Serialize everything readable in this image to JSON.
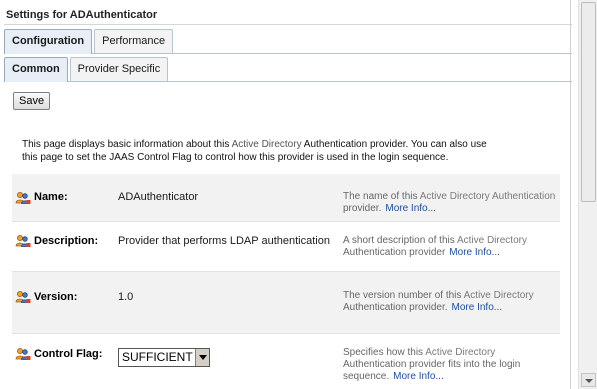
{
  "header": {
    "title": "Settings for ADAuthenticator"
  },
  "tabs_primary": [
    {
      "label": "Configuration",
      "active": true
    },
    {
      "label": "Performance",
      "active": false
    }
  ],
  "tabs_secondary": [
    {
      "label": "Common",
      "active": true
    },
    {
      "label": "Provider Specific",
      "active": false
    }
  ],
  "toolbar": {
    "save_label": "Save"
  },
  "intro": {
    "line1_a": "This page displays basic information about this ",
    "line1_hl": "Active Directory",
    "line1_b": " Authentication provider.  You can also use",
    "line2": "this page to set the JAAS Control Flag to control how this provider is used in the login sequence."
  },
  "fields": {
    "name": {
      "label": "Name:",
      "value": "ADAuthenticator",
      "help_a": "The name of this ",
      "help_hl": "Active Directory Authentication",
      "help_b": "provider.",
      "more": "More Info..."
    },
    "description": {
      "label": "Description:",
      "value": "Provider that performs LDAP authentication",
      "help_a": "A short description of this ",
      "help_hl": "Active Directory",
      "help_b": "Authentication provider",
      "more": "More Info..."
    },
    "version": {
      "label": "Version:",
      "value": "1.0",
      "help_a": "The version number of this ",
      "help_hl": "Active Directory",
      "help_b": "Authentication provider.",
      "more": "More Info..."
    },
    "control_flag": {
      "label": "Control Flag:",
      "value": "SUFFICIENT",
      "help_a": "Specifies how this ",
      "help_hl": "Active Directory",
      "help_b": "Authentication provider fits into the login",
      "help_c": "sequence.",
      "more": "More Info..."
    }
  },
  "icons": {
    "field": "people-settings-icon"
  },
  "colors": {
    "link": "#1f4ea0",
    "tab_active": "#e7eef5",
    "row_shade": "#f2f2f2"
  }
}
